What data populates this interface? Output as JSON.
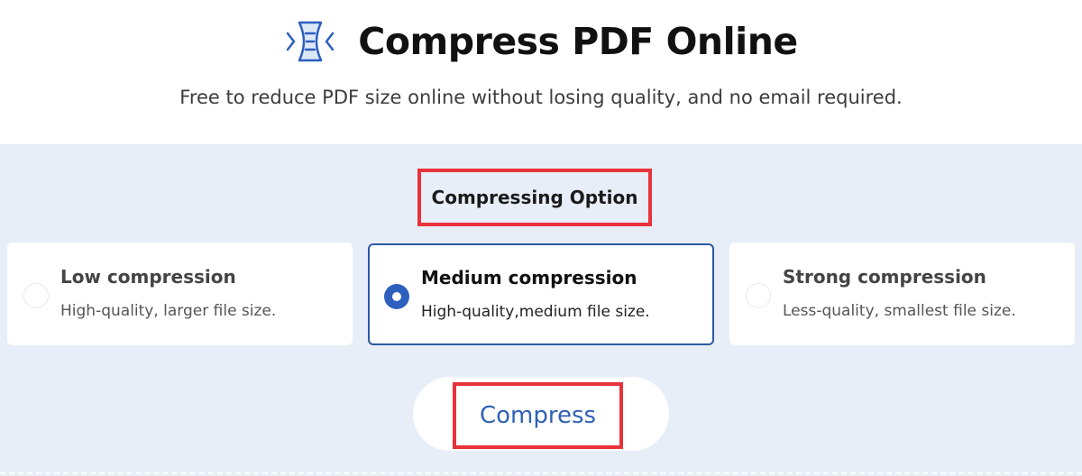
{
  "header": {
    "logo_icon": "compress-icon",
    "title": "Compress PDF Online",
    "subtitle": "Free to reduce PDF size online without losing quality, and no email required."
  },
  "options_section": {
    "title": "Compressing Option",
    "options": [
      {
        "title": "Low compression",
        "description": "High-quality, larger file size.",
        "selected": false
      },
      {
        "title": "Medium compression",
        "description": "High-quality,medium file size.",
        "selected": true
      },
      {
        "title": "Strong compression",
        "description": "Less-quality, smallest file size.",
        "selected": false
      }
    ]
  },
  "actions": {
    "compress_label": "Compress"
  },
  "colors": {
    "accent": "#2d5fbe",
    "panel_bg": "#e8eef8",
    "highlight_border": "#e8333b",
    "text": "#111111"
  }
}
